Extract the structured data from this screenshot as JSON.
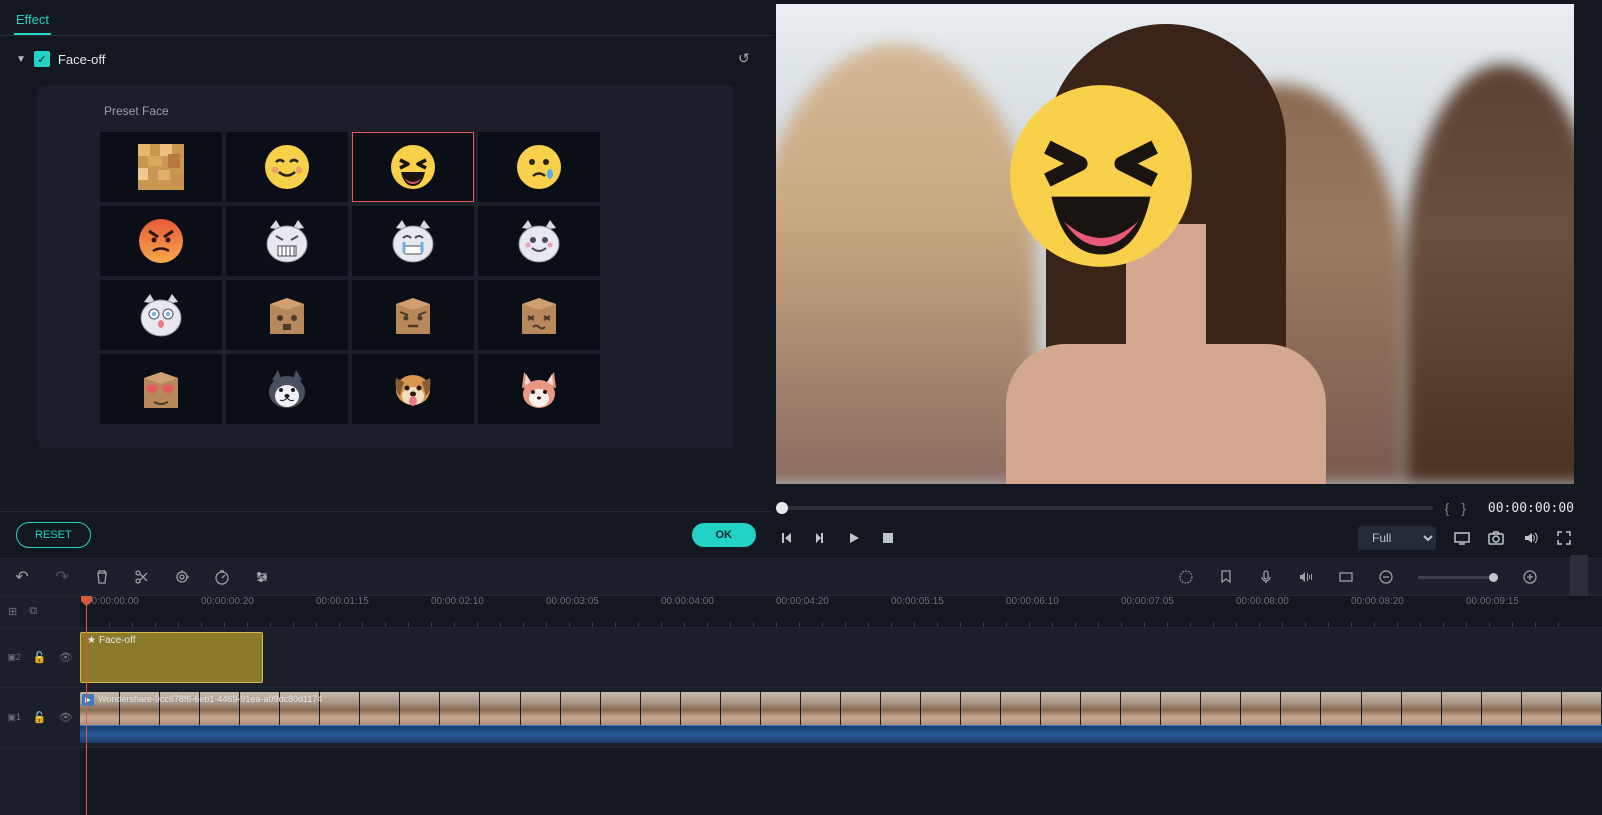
{
  "tabbar": {
    "effect": "Effect"
  },
  "section": {
    "title": "Face-off",
    "checked": true
  },
  "preset": {
    "label": "Preset Face",
    "items": [
      {
        "id": "mosaic",
        "name": "mosaic"
      },
      {
        "id": "smile",
        "name": "smile-face"
      },
      {
        "id": "laugh",
        "name": "laugh-face"
      },
      {
        "id": "cry",
        "name": "cry-face"
      },
      {
        "id": "angry",
        "name": "angry-face"
      },
      {
        "id": "cat-angry",
        "name": "cat-angry-face"
      },
      {
        "id": "cat-cry",
        "name": "cat-cry-face"
      },
      {
        "id": "cat-happy",
        "name": "cat-happy-face"
      },
      {
        "id": "cat-surprise",
        "name": "cat-surprise-face"
      },
      {
        "id": "box-surprise",
        "name": "box-surprise"
      },
      {
        "id": "box-confused",
        "name": "box-confused"
      },
      {
        "id": "box-sick",
        "name": "box-sick"
      },
      {
        "id": "box-love",
        "name": "box-love"
      },
      {
        "id": "husky",
        "name": "dog-husky"
      },
      {
        "id": "puppy",
        "name": "dog-puppy"
      },
      {
        "id": "fox",
        "name": "fox-face"
      }
    ],
    "selected_index": 2
  },
  "footer": {
    "reset": "RESET",
    "ok": "OK"
  },
  "preview": {
    "quality": "Full",
    "timecode": "00:00:00:00",
    "brace_open": "{",
    "brace_close": "}"
  },
  "ruler": {
    "labels": [
      "00:00:00:00",
      "00:00:00:20",
      "00:00:01:15",
      "00:00:02:10",
      "00:00:03:05",
      "00:00:04:00",
      "00:00:04:20",
      "00:00:05:15",
      "00:00:06:10",
      "00:00:07:05",
      "00:00:08:00",
      "00:00:08:20",
      "00:00:09:15"
    ]
  },
  "tracks": {
    "t2": {
      "label": "2",
      "clip_label": "Face-off"
    },
    "t1": {
      "label": "1",
      "clip_label": "Wondershare-9cc678f6-6eb1-4469-91ea-a09dc80d1174"
    }
  }
}
